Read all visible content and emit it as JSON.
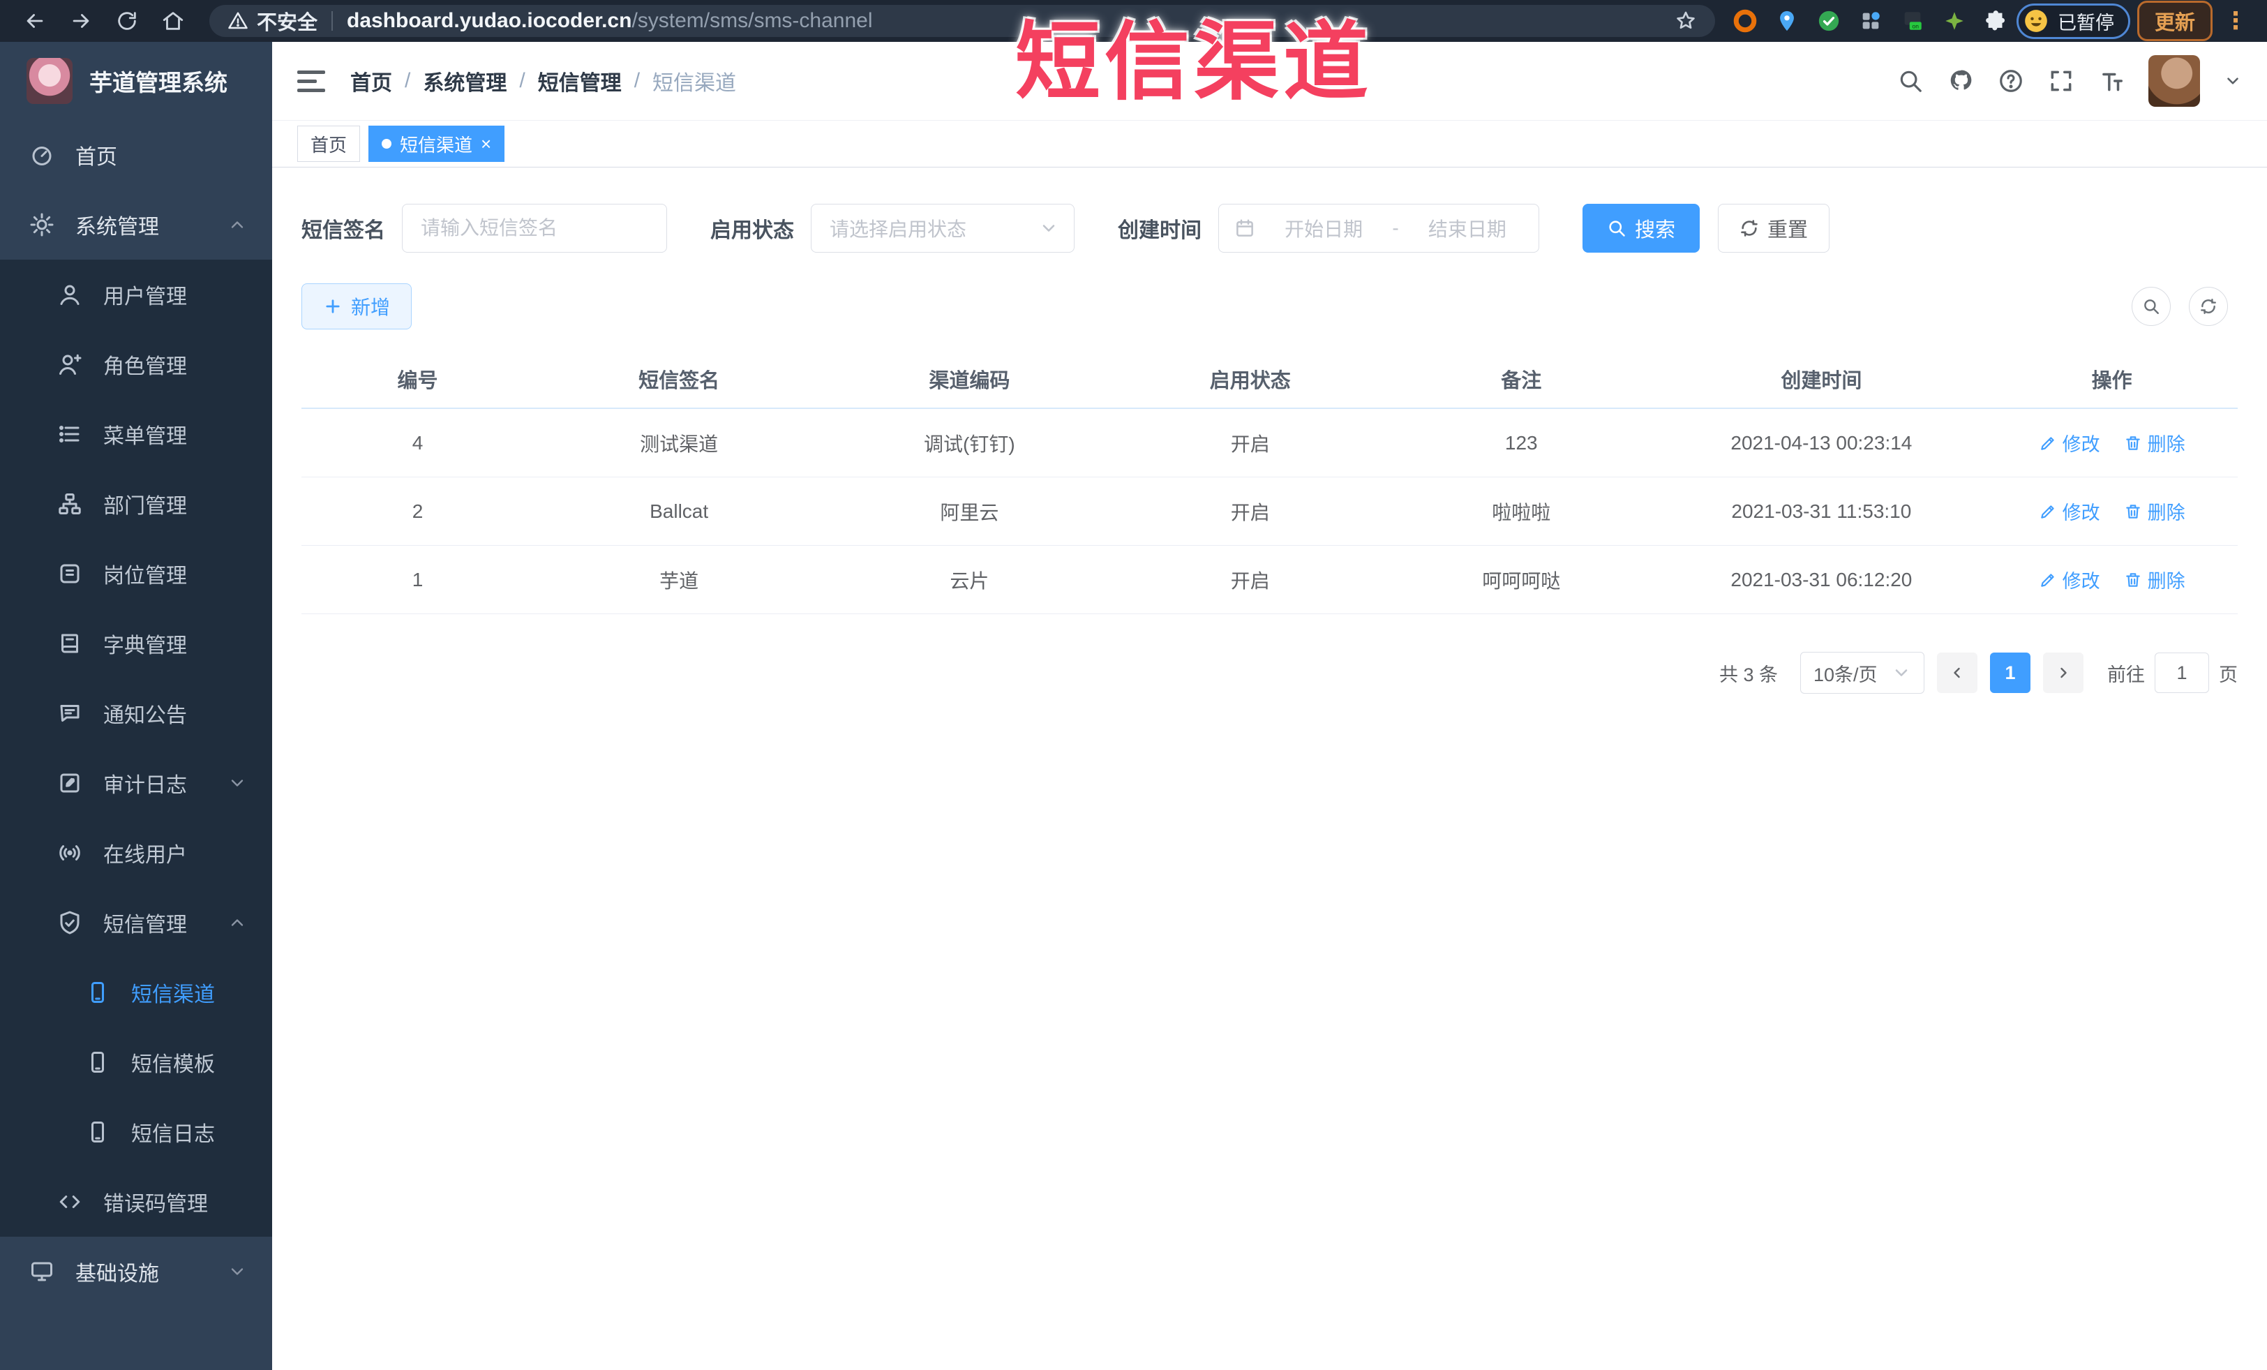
{
  "browser": {
    "security_label": "不安全",
    "url_host": "dashboard.yudao.iocoder.cn",
    "url_path": "/system/sms/sms-channel",
    "paused_badge": "已暂停",
    "update_button": "更新",
    "nav_icons": [
      "back-icon",
      "forward-icon",
      "reload-icon",
      "home-icon"
    ],
    "extensions": [
      "orange-ring-extension-icon",
      "blue-pin-extension-icon",
      "green-check-extension-icon",
      "grid-extension-icon",
      "dark-on-extension-icon",
      "green-clover-extension-icon",
      "puzzle-extensions-icon"
    ]
  },
  "annotation": {
    "title": "短信渠道",
    "color": "#f4405f"
  },
  "sidebar": {
    "logo_title": "芋道管理系统",
    "items": [
      {
        "label": "首页",
        "icon": "dashboard-icon",
        "level": 0,
        "caret": "",
        "active": false
      },
      {
        "label": "系统管理",
        "icon": "gear-icon",
        "level": 0,
        "caret": "up",
        "active": false
      },
      {
        "label": "用户管理",
        "icon": "user-icon",
        "level": 1,
        "caret": "",
        "active": false
      },
      {
        "label": "角色管理",
        "icon": "role-icon",
        "level": 1,
        "caret": "",
        "active": false
      },
      {
        "label": "菜单管理",
        "icon": "menu-list-icon",
        "level": 1,
        "caret": "",
        "active": false
      },
      {
        "label": "部门管理",
        "icon": "dept-tree-icon",
        "level": 1,
        "caret": "",
        "active": false
      },
      {
        "label": "岗位管理",
        "icon": "post-icon",
        "level": 1,
        "caret": "",
        "active": false
      },
      {
        "label": "字典管理",
        "icon": "dict-icon",
        "level": 1,
        "caret": "",
        "active": false
      },
      {
        "label": "通知公告",
        "icon": "notice-icon",
        "level": 1,
        "caret": "",
        "active": false
      },
      {
        "label": "审计日志",
        "icon": "audit-log-icon",
        "level": 1,
        "caret": "down",
        "active": false
      },
      {
        "label": "在线用户",
        "icon": "online-user-icon",
        "level": 1,
        "caret": "",
        "active": false
      },
      {
        "label": "短信管理",
        "icon": "sms-shield-icon",
        "level": 1,
        "caret": "up",
        "active": false
      },
      {
        "label": "短信渠道",
        "icon": "phone-icon",
        "level": 2,
        "caret": "",
        "active": true
      },
      {
        "label": "短信模板",
        "icon": "phone-icon",
        "level": 2,
        "caret": "",
        "active": false
      },
      {
        "label": "短信日志",
        "icon": "phone-icon",
        "level": 2,
        "caret": "",
        "active": false
      },
      {
        "label": "错误码管理",
        "icon": "code-icon",
        "level": 1,
        "caret": "",
        "active": false
      },
      {
        "label": "基础设施",
        "icon": "monitor-icon",
        "level": 0,
        "caret": "down",
        "active": false
      }
    ]
  },
  "header": {
    "breadcrumb": [
      "首页",
      "系统管理",
      "短信管理",
      "短信渠道"
    ],
    "icons": [
      "search-icon",
      "github-icon",
      "help-icon",
      "fullscreen-icon",
      "font-size-icon"
    ]
  },
  "tabs": [
    {
      "label": "首页",
      "active": false
    },
    {
      "label": "短信渠道",
      "active": true
    }
  ],
  "filters": {
    "sign_label": "短信签名",
    "sign_placeholder": "请输入短信签名",
    "status_label": "启用状态",
    "status_placeholder": "请选择启用状态",
    "date_label": "创建时间",
    "date_start_placeholder": "开始日期",
    "date_separator": "-",
    "date_end_placeholder": "结束日期",
    "search_label": "搜索",
    "reset_label": "重置"
  },
  "toolbar": {
    "add_label": "新增"
  },
  "table": {
    "columns": [
      "编号",
      "短信签名",
      "渠道编码",
      "启用状态",
      "备注",
      "创建时间",
      "操作"
    ],
    "edit_label": "修改",
    "delete_label": "删除",
    "rows": [
      {
        "id": "4",
        "sign": "测试渠道",
        "code": "调试(钉钉)",
        "status": "开启",
        "remark": "123",
        "created": "2021-04-13 00:23:14"
      },
      {
        "id": "2",
        "sign": "Ballcat",
        "code": "阿里云",
        "status": "开启",
        "remark": "啦啦啦",
        "created": "2021-03-31 11:53:10"
      },
      {
        "id": "1",
        "sign": "芋道",
        "code": "云片",
        "status": "开启",
        "remark": "呵呵呵哒",
        "created": "2021-03-31 06:12:20"
      }
    ]
  },
  "pagination": {
    "total_text": "共 3 条",
    "page_size": "10条/页",
    "current_page": "1",
    "goto_prefix": "前往",
    "goto_value": "1",
    "goto_suffix": "页"
  }
}
